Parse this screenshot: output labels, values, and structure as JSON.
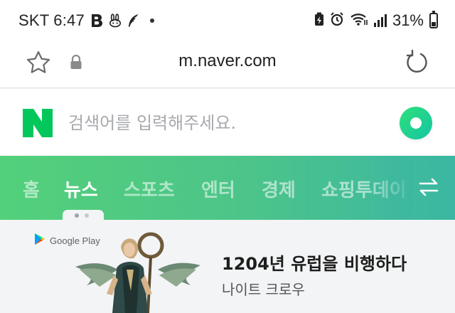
{
  "status_bar": {
    "carrier_time": "SKT 6:47",
    "app_icons": [
      "b-app-icon",
      "rabbit-app-icon",
      "feather-app-icon"
    ],
    "battery_percent": "31%",
    "battery_level": 0.31,
    "right_icons": [
      "battery-saver-icon",
      "alarm-icon",
      "wifi-icon",
      "signal-icon"
    ]
  },
  "browser": {
    "url": "m.naver.com",
    "bookmark_icon": "star-icon",
    "secure_icon": "lock-icon",
    "refresh_icon": "refresh-icon"
  },
  "search": {
    "logo": "N",
    "placeholder": "검색어를 입력해주세요.",
    "value": "",
    "green_button_icon": "green-dot-icon"
  },
  "tabs": {
    "items": [
      {
        "label": "홈",
        "active": false
      },
      {
        "label": "뉴스",
        "active": true
      },
      {
        "label": "스포츠",
        "active": false
      },
      {
        "label": "엔터",
        "active": false
      },
      {
        "label": "경제",
        "active": false
      },
      {
        "label": "쇼핑투데이",
        "active": false
      }
    ],
    "toggle_icon": "swap-arrows-icon",
    "page_dots": 2,
    "active_page_dot": 0
  },
  "ad": {
    "badge_label": "Google Play",
    "title": "1204년 유럽을 비행하다",
    "subtitle": "나이트 크로우"
  },
  "colors": {
    "tab_gradient_start": "#53d07a",
    "tab_gradient_end": "#3bb7a3",
    "naver_green": "#03c75a",
    "page_background": "#f3f4f5"
  }
}
